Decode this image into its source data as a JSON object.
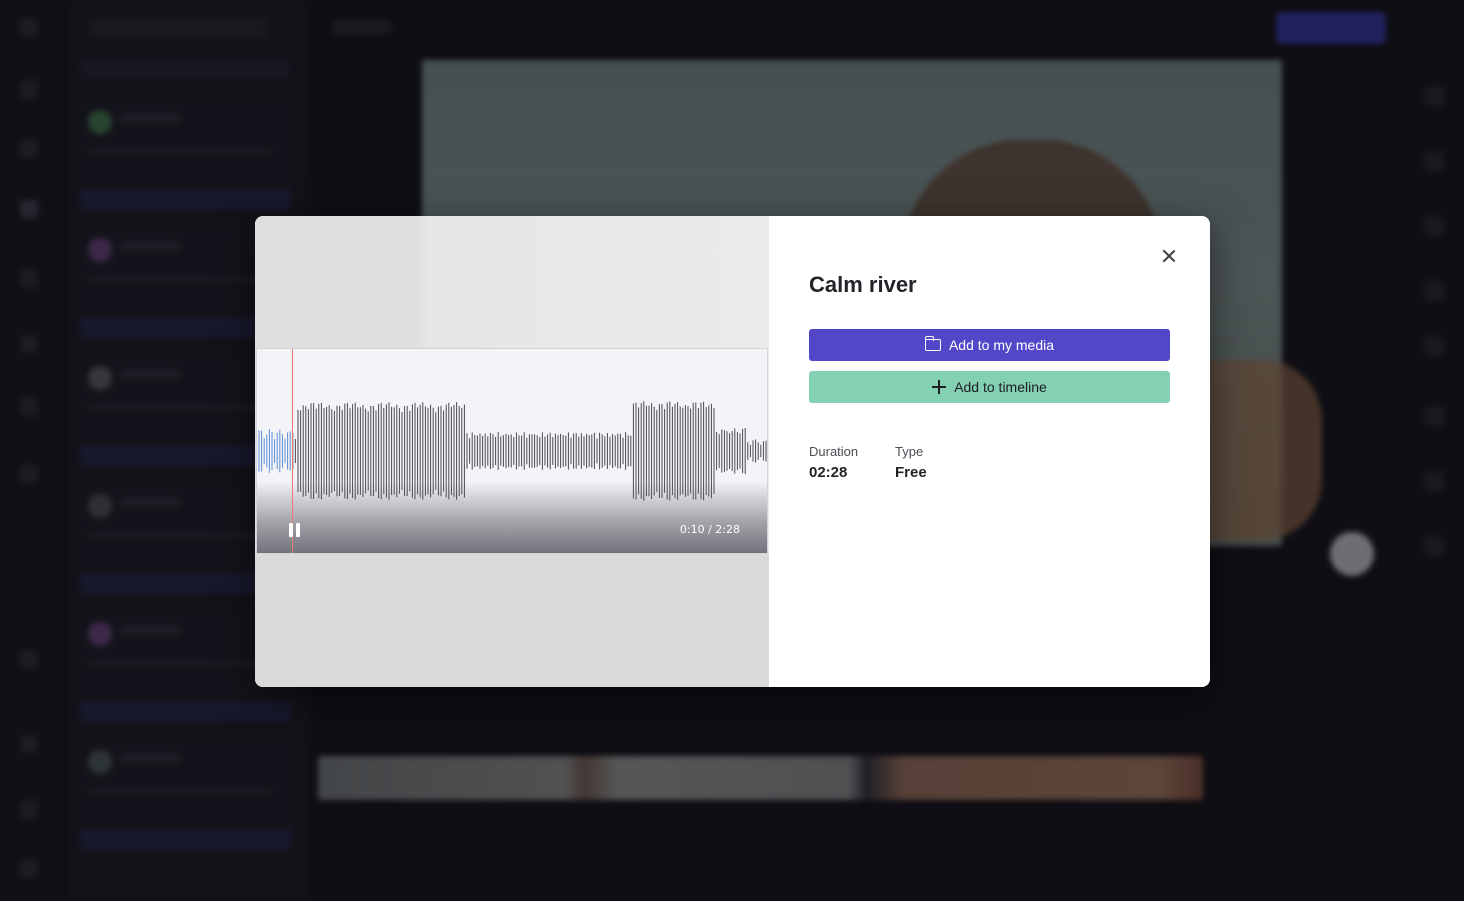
{
  "dialog": {
    "title": "Calm river",
    "add_media_label": "Add to my media",
    "add_timeline_label": "Add to timeline",
    "close_icon": "close-icon",
    "meta": [
      {
        "key": "Duration",
        "value": "02:28"
      },
      {
        "key": "Type",
        "value": "Free"
      }
    ]
  },
  "player": {
    "time_display": "0:10 / 2:28",
    "progress_seconds": 10,
    "duration_seconds": 148,
    "state": "playing",
    "pause_icon": "pause-icon"
  },
  "colors": {
    "primary_button": "#5247c8",
    "secondary_button": "#84d0b3",
    "waveform_played": "#5b8fd6",
    "waveform_unplayed": "#4a4a55",
    "playhead": "#e77c6c"
  }
}
